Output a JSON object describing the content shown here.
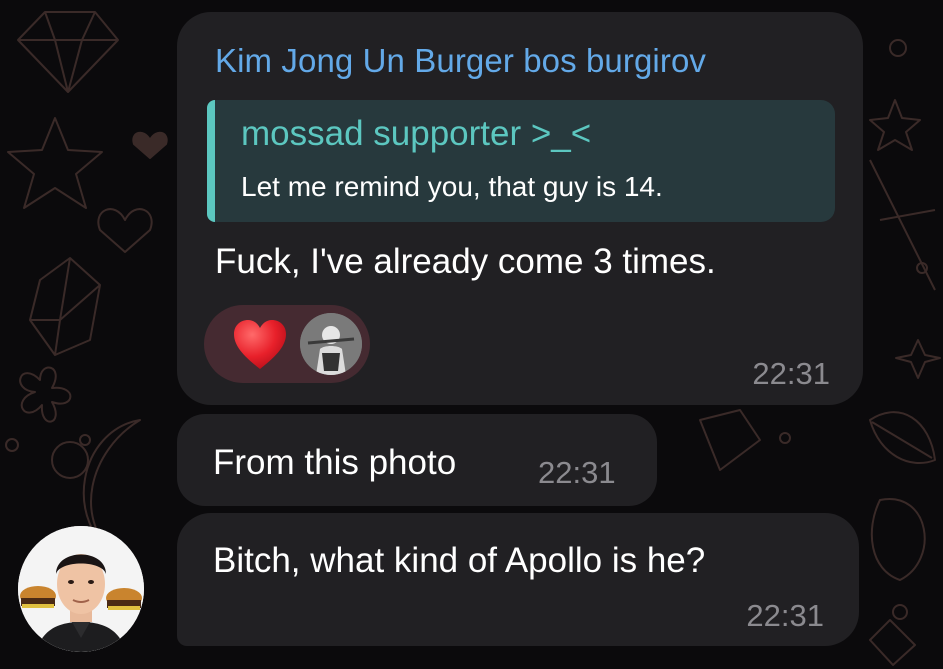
{
  "chat": {
    "messages": [
      {
        "sender": "Kim Jong Un Burger bos burgirov",
        "reply": {
          "name": "mossad supporter >_<",
          "text": "Let me remind you, that guy is 14."
        },
        "text": "Fuck, I've already come 3 times.",
        "reactions": [
          "heart-emoji",
          "user-avatar"
        ],
        "time": "22:31"
      },
      {
        "text": "From this photo",
        "time": "22:31"
      },
      {
        "text": "Bitch, what kind of Apollo is he?",
        "time": "22:31"
      }
    ]
  },
  "colors": {
    "background": "#0b0a0c",
    "bubble": "#212023",
    "sender_name": "#63a9e8",
    "reply_accent": "#5cc7c0",
    "reply_background": "#27393d",
    "reaction_background": "#452a31",
    "time": "#8b8a8f",
    "heart": "#e8202a"
  }
}
